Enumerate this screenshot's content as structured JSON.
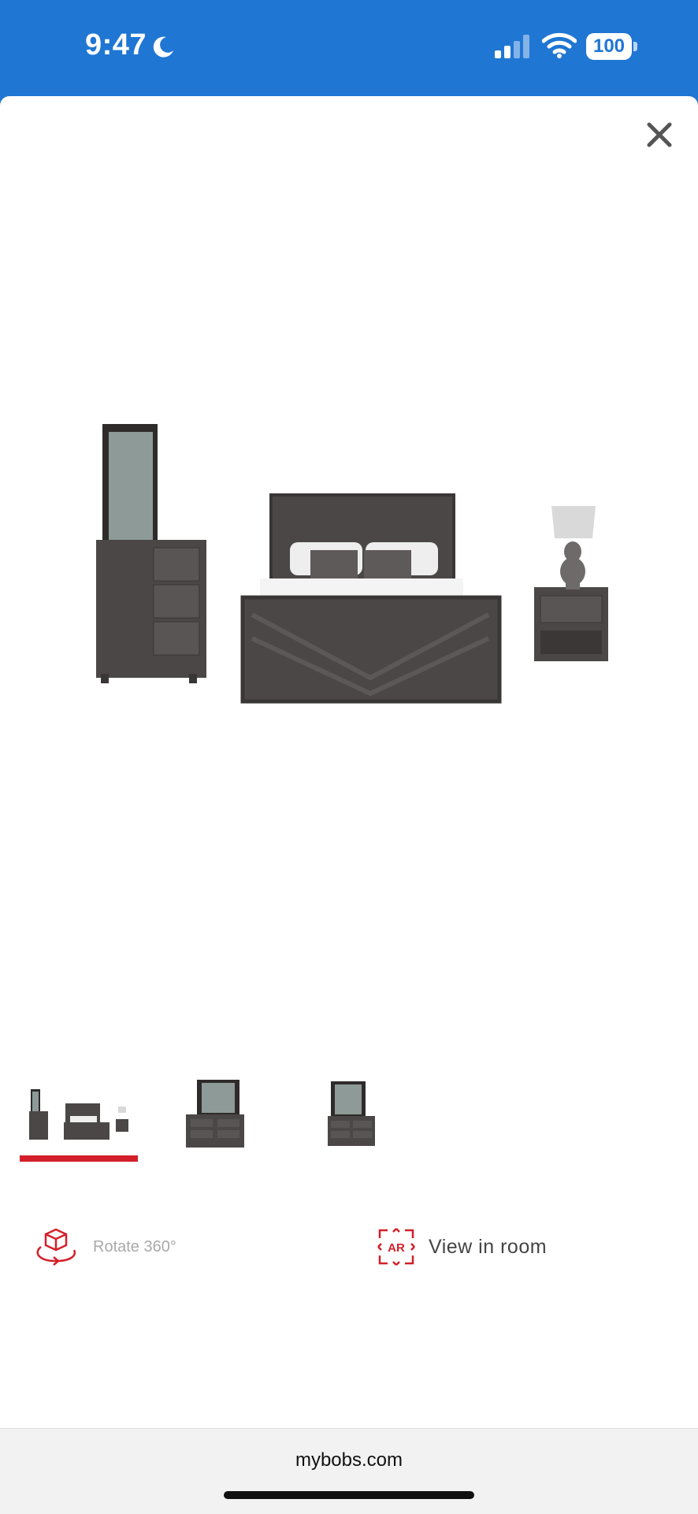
{
  "status_bar": {
    "time": "9:47",
    "battery": "100"
  },
  "colors": {
    "status_bar_bg": "#1f76d3",
    "accent_red": "#d3202a",
    "wood_dark": "#4b4747"
  },
  "viewer": {
    "close_icon": "close-icon",
    "thumbnails": [
      {
        "icon": "bedroom-set-thumbnail",
        "active": true
      },
      {
        "icon": "dresser-mirror-thumbnail",
        "active": false
      },
      {
        "icon": "dresser-mirror-alt-thumbnail",
        "active": false
      }
    ]
  },
  "actions": {
    "rotate_label": "Rotate 360°",
    "ar_label": "View in room",
    "ar_icon_text": "AR"
  },
  "browser": {
    "url": "mybobs.com"
  }
}
